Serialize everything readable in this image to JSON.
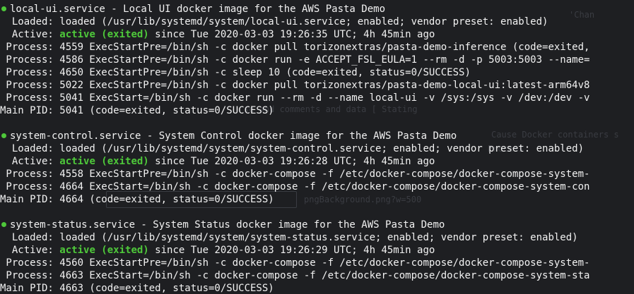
{
  "background_colors": {
    "terminal": "#1e1f22",
    "active": "#4ec83a"
  },
  "ghost_text": {
    "g1": "'Chan",
    "g2": "se and comments and data [ Stating",
    "g3": "Cause Docker containers s",
    "g4": "Process",
    "g5": "pngBackground.png?w=500"
  },
  "services": [
    {
      "header": "local-ui.service - Local UI docker image for the AWS Pasta Demo",
      "loaded": "  Loaded: loaded (/usr/lib/systemd/system/local-ui.service; enabled; vendor preset: enabled)",
      "active_prefix": "  Active: ",
      "active_state": "active (exited)",
      "active_suffix": " since Tue 2020-03-03 19:26:35 UTC; 4h 45min ago",
      "processes": [
        " Process: 4559 ExecStartPre=/bin/sh -c docker pull torizonextras/pasta-demo-inference (code=exited,",
        " Process: 4586 ExecStartPre=/bin/sh -c docker run -e ACCEPT_FSL_EULA=1 --rm -d -p 5003:5003 --name=",
        " Process: 4650 ExecStartPre=/bin/sh -c sleep 10 (code=exited, status=0/SUCCESS)",
        " Process: 5022 ExecStartPre=/bin/sh -c docker pull torizonextras/pasta-demo-local-ui:latest-arm64v8",
        " Process: 5041 ExecStart=/bin/sh -c docker run --rm -d --name local-ui -v /sys:/sys -v /dev:/dev -v"
      ],
      "main_pid": "Main PID: 5041 (code=exited, status=0/SUCCESS)"
    },
    {
      "header": "system-control.service - System Control docker image for the AWS Pasta Demo",
      "loaded": "  Loaded: loaded (/usr/lib/systemd/system/system-control.service; enabled; vendor preset: enabled)",
      "active_prefix": "  Active: ",
      "active_state": "active (exited)",
      "active_suffix": " since Tue 2020-03-03 19:26:28 UTC; 4h 45min ago",
      "processes": [
        " Process: 4558 ExecStartPre=/bin/sh -c docker-compose -f /etc/docker-compose/docker-compose-system-",
        " Process: 4664 ExecStart=/bin/sh -c docker-compose -f /etc/docker-compose/docker-compose-system-con"
      ],
      "main_pid": "Main PID: 4664 (code=exited, status=0/SUCCESS)"
    },
    {
      "header": "system-status.service - System Status docker image for the AWS Pasta Demo",
      "loaded": "  Loaded: loaded (/usr/lib/systemd/system/system-status.service; enabled; vendor preset: enabled)",
      "active_prefix": "  Active: ",
      "active_state": "active (exited)",
      "active_suffix": " since Tue 2020-03-03 19:26:29 UTC; 4h 45min ago",
      "processes": [
        " Process: 4560 ExecStartPre=/bin/sh -c docker-compose -f /etc/docker-compose/docker-compose-system-",
        " Process: 4663 ExecStart=/bin/sh -c docker-compose -f /etc/docker-compose/docker-compose-system-sta"
      ],
      "main_pid": "Main PID: 4663 (code=exited, status=0/SUCCESS)"
    }
  ]
}
